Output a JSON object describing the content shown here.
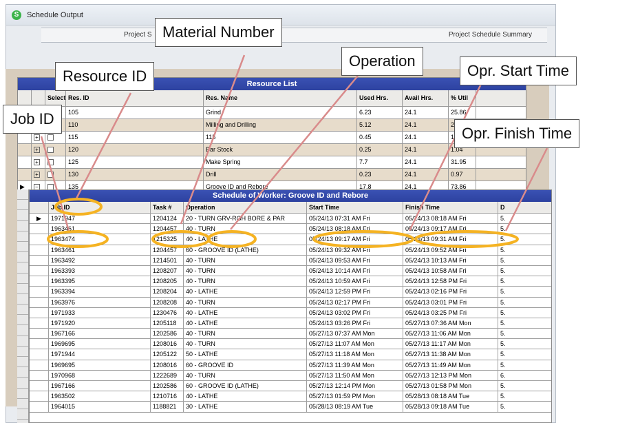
{
  "window": {
    "title": "Schedule Output",
    "tab_left": "Project S",
    "tab_right": "Project Schedule Summary"
  },
  "resource_list": {
    "title": "Resource List",
    "columns": [
      "Select",
      "Res. ID",
      "Res. Name",
      "Used Hrs.",
      "Avail Hrs.",
      "% Util"
    ],
    "rows": [
      {
        "id": "105",
        "name": "Grind",
        "used": "6.23",
        "avail": "24.1",
        "util": "25.86"
      },
      {
        "id": "110",
        "name": "Milling and Drilling",
        "used": "5.12",
        "avail": "24.1",
        "util": "21.23"
      },
      {
        "id": "115",
        "name": "115",
        "used": "0.45",
        "avail": "24.1",
        "util": "1.87"
      },
      {
        "id": "120",
        "name": "Bar Stock",
        "used": "0.25",
        "avail": "24.1",
        "util": "1.04"
      },
      {
        "id": "125",
        "name": "Make Spring",
        "used": "7.7",
        "avail": "24.1",
        "util": "31.95"
      },
      {
        "id": "130",
        "name": "Drill",
        "used": "0.23",
        "avail": "24.1",
        "util": "0.97"
      },
      {
        "id": "135",
        "name": "Groove ID and Rebore",
        "used": "17.8",
        "avail": "24.1",
        "util": "73.86"
      }
    ]
  },
  "worker_schedule": {
    "title": "Schedule of Worker: Groove ID and Rebore",
    "columns": [
      "Job ID",
      "Task #",
      "Operation",
      "Start Time",
      "Finish Time",
      "D"
    ],
    "rows": [
      [
        "1971947",
        "1204124",
        "20 - TURN GRV-RGH BORE & PAR",
        "05/24/13 07:31 AM Fri",
        "05/24/13 08:18 AM Fri",
        "5."
      ],
      [
        "1963461",
        "1204457",
        "40 - TURN",
        "05/24/13 08:18 AM Fri",
        "05/24/13 09:17 AM Fri",
        "5."
      ],
      [
        "1963474",
        "1215325",
        "40 - LATHE",
        "05/24/13 09:17 AM Fri",
        "05/24/13 09:31 AM Fri",
        "5."
      ],
      [
        "1963461",
        "1204457",
        "60 - GROOVE ID (LATHE)",
        "05/24/13 09:32 AM Fri",
        "05/24/13 09:52 AM Fri",
        "5."
      ],
      [
        "1963492",
        "1214501",
        "40 - TURN",
        "05/24/13 09:53 AM Fri",
        "05/24/13 10:13 AM Fri",
        "5."
      ],
      [
        "1963393",
        "1208207",
        "40 - TURN",
        "05/24/13 10:14 AM Fri",
        "05/24/13 10:58 AM Fri",
        "5."
      ],
      [
        "1963395",
        "1208205",
        "40 - TURN",
        "05/24/13 10:59 AM Fri",
        "05/24/13 12:58 PM Fri",
        "5."
      ],
      [
        "1963394",
        "1208204",
        "40 - LATHE",
        "05/24/13 12:59 PM Fri",
        "05/24/13 02:16 PM Fri",
        "5."
      ],
      [
        "1963976",
        "1208208",
        "40 - TURN",
        "05/24/13 02:17 PM Fri",
        "05/24/13 03:01 PM Fri",
        "5."
      ],
      [
        "1971933",
        "1230476",
        "40 - LATHE",
        "05/24/13 03:02 PM Fri",
        "05/24/13 03:25 PM Fri",
        "5."
      ],
      [
        "1971920",
        "1205118",
        "40 - LATHE",
        "05/24/13 03:26 PM Fri",
        "05/27/13 07:36 AM Mon",
        "5."
      ],
      [
        "1967166",
        "1202586",
        "40 - TURN",
        "05/27/13 07:37 AM Mon",
        "05/27/13 11:06 AM Mon",
        "5."
      ],
      [
        "1969695",
        "1208016",
        "40 - TURN",
        "05/27/13 11:07 AM Mon",
        "05/27/13 11:17 AM Mon",
        "5."
      ],
      [
        "1971944",
        "1205122",
        "50 - LATHE",
        "05/27/13 11:18 AM Mon",
        "05/27/13 11:38 AM Mon",
        "5."
      ],
      [
        "1969695",
        "1208016",
        "60 - GROOVE ID",
        "05/27/13 11:39 AM Mon",
        "05/27/13 11:49 AM Mon",
        "5."
      ],
      [
        "1970968",
        "1222689",
        "40 - TURN",
        "05/27/13 11:50 AM Mon",
        "05/27/13 12:13 PM Mon",
        "6."
      ],
      [
        "1967166",
        "1202586",
        "60 - GROOVE ID (LATHE)",
        "05/27/13 12:14 PM Mon",
        "05/27/13 01:58 PM Mon",
        "5."
      ],
      [
        "1963502",
        "1210716",
        "40 - LATHE",
        "05/27/13 01:59 PM Mon",
        "05/28/13 08:18 AM Tue",
        "5."
      ],
      [
        "1964015",
        "1188821",
        "30 - LATHE",
        "05/28/13 08:19 AM Tue",
        "05/28/13 09:18 AM Tue",
        "5."
      ]
    ]
  },
  "callouts": {
    "material_number": "Material Number",
    "resource_id": "Resource ID",
    "operation": "Operation",
    "opr_start_time": "Opr. Start Time",
    "job_id": "Job ID",
    "opr_finish_time": "Opr. Finish Time"
  },
  "colors": {
    "band": "#2d42a0",
    "alt_row": "#e7dccb",
    "highlight": "#f5b323",
    "arrow": "#d98b8b"
  }
}
